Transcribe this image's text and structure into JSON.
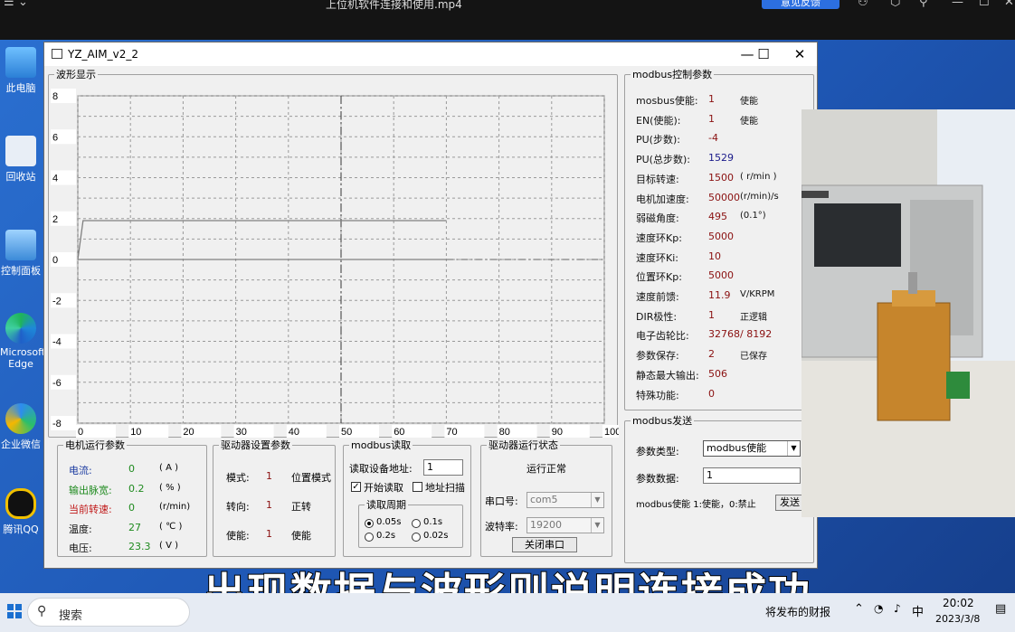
{
  "player": {
    "title": "上位机软件连接和使用.mp4",
    "feedback_label": "意见反馈"
  },
  "desktop_icons": [
    {
      "label": "此电脑",
      "icon": "this-pc-icon"
    },
    {
      "label": "回收站",
      "icon": "recycle-bin-icon"
    },
    {
      "label": "控制面板",
      "icon": "control-panel-icon"
    },
    {
      "label": "Microsoft Edge",
      "icon": "edge-icon"
    },
    {
      "label": "企业微信",
      "icon": "wecom-icon"
    },
    {
      "label": "腾讯QQ",
      "icon": "qq-icon"
    }
  ],
  "window": {
    "title": "YZ_AIM_v2_2",
    "minimize": "—",
    "maximize": "☐",
    "close": "✕"
  },
  "waveform": {
    "group_title": "波形显示"
  },
  "chart_data": {
    "type": "line",
    "title": "",
    "xlabel": "",
    "ylabel": "",
    "x_ticks": [
      "0",
      "10",
      "20",
      "30",
      "40",
      "50",
      "60",
      "70",
      "80",
      "90",
      "100"
    ],
    "y_ticks": [
      "8",
      "6",
      "4",
      "2",
      "0",
      "-2",
      "-4",
      "-6",
      "-8"
    ],
    "xlim": [
      0,
      100
    ],
    "ylim": [
      -8,
      8
    ],
    "grid": true,
    "series": [
      {
        "x": [
          0,
          1,
          70
        ],
        "y": [
          0,
          1.9,
          1.9
        ],
        "style": "solid",
        "color": "#808080"
      },
      {
        "x": [
          0,
          70
        ],
        "y": [
          0,
          0
        ],
        "style": "solid",
        "color": "#808080"
      },
      {
        "x": [
          70,
          100
        ],
        "y": [
          0,
          0
        ],
        "style": "dashdot",
        "color": "#808080"
      }
    ],
    "cursor_x": 50
  },
  "modbus_params": {
    "title": "modbus控制参数",
    "rows": [
      {
        "label": "mosbus使能:",
        "value": "1",
        "unit": "使能",
        "value_color": "#8a1010"
      },
      {
        "label": "EN(使能):",
        "value": "1",
        "unit": "使能",
        "value_color": "#8a1010"
      },
      {
        "label": "PU(步数):",
        "value": "-4",
        "unit": "",
        "value_color": "#8a1010"
      },
      {
        "label": "PU(总步数):",
        "value": "1529",
        "unit": "",
        "value_color": "#1a1a8a"
      },
      {
        "label": "目标转速:",
        "value": "1500",
        "unit": "( r/min )",
        "value_color": "#8a1010"
      },
      {
        "label": "电机加速度:",
        "value": "50000",
        "unit": "(r/min)/s",
        "value_color": "#8a1010"
      },
      {
        "label": "弱磁角度:",
        "value": "495",
        "unit": "(0.1°)",
        "value_color": "#8a1010"
      },
      {
        "label": "速度环Kp:",
        "value": "5000",
        "unit": "",
        "value_color": "#8a1010"
      },
      {
        "label": "速度环Ki:",
        "value": "10",
        "unit": "",
        "value_color": "#8a1010"
      },
      {
        "label": "位置环Kp:",
        "value": "5000",
        "unit": "",
        "value_color": "#8a1010"
      },
      {
        "label": "速度前馈:",
        "value": "11.9",
        "unit": "V/KRPM",
        "value_color": "#8a1010"
      },
      {
        "label": "DIR极性:",
        "value": "1",
        "unit": "正逻辑",
        "value_color": "#8a1010"
      },
      {
        "label": "电子齿轮比:",
        "value": "32768/ 8192",
        "unit": "",
        "value_color": "#8a1010"
      },
      {
        "label": "参数保存:",
        "value": "2",
        "unit": "已保存",
        "value_color": "#8a1010"
      },
      {
        "label": "静态最大输出:",
        "value": "506",
        "unit": "",
        "value_color": "#8a1010"
      },
      {
        "label": "特殊功能:",
        "value": "0",
        "unit": "",
        "value_color": "#8a1010"
      }
    ]
  },
  "motor_status": {
    "title": "电机运行参数",
    "rows": [
      {
        "label": "电流:",
        "value": "0",
        "unit": "( A )",
        "label_color": "#1a3aa0"
      },
      {
        "label": "输出脉宽:",
        "value": "0.2",
        "unit": "( % )",
        "label_color": "#1e8a1e"
      },
      {
        "label": "当前转速:",
        "value": "0",
        "unit": "(r/min)",
        "label_color": "#c01818"
      },
      {
        "label": "温度:",
        "value": "27",
        "unit": "( ℃ )",
        "label_color": "#111111"
      },
      {
        "label": "电压:",
        "value": "23.3",
        "unit": "( V )",
        "label_color": "#111111"
      }
    ]
  },
  "driver_settings": {
    "title": "驱动器设置参数",
    "rows": [
      {
        "label": "模式:",
        "value": "1",
        "desc": "位置模式"
      },
      {
        "label": "转向:",
        "value": "1",
        "desc": "正转"
      },
      {
        "label": "使能:",
        "value": "1",
        "desc": "使能"
      }
    ]
  },
  "modbus_read": {
    "title": "modbus读取",
    "address_label": "读取设备地址:",
    "address_value": "1",
    "start_read_label": "开始读取",
    "start_read_checked": true,
    "addr_scan_label": "地址扫描",
    "addr_scan_checked": false,
    "period_title": "读取周期",
    "periods": [
      {
        "label": "0.05s",
        "selected": true
      },
      {
        "label": "0.1s",
        "selected": false
      },
      {
        "label": "0.2s",
        "selected": false
      },
      {
        "label": "0.02s",
        "selected": false
      }
    ]
  },
  "driver_state": {
    "title": "驱动器运行状态",
    "status": "运行正常",
    "port_label": "串口号:",
    "port_value": "com5",
    "baud_label": "波特率:",
    "baud_value": "19200",
    "close_port_button": "关闭串口"
  },
  "modbus_send": {
    "title": "modbus发送",
    "type_label": "参数类型:",
    "type_value": "modbus使能",
    "data_label": "参数数据:",
    "data_value": "1",
    "hint": "modbus使能 1:使能，0:禁止",
    "send_button": "发送"
  },
  "subtitle": "出现数据与波形则说明连接成功",
  "taskbar": {
    "search_label": "搜索",
    "news": "将发布的财报",
    "ime": "中",
    "time": "20:02",
    "date": "2023/3/8"
  }
}
